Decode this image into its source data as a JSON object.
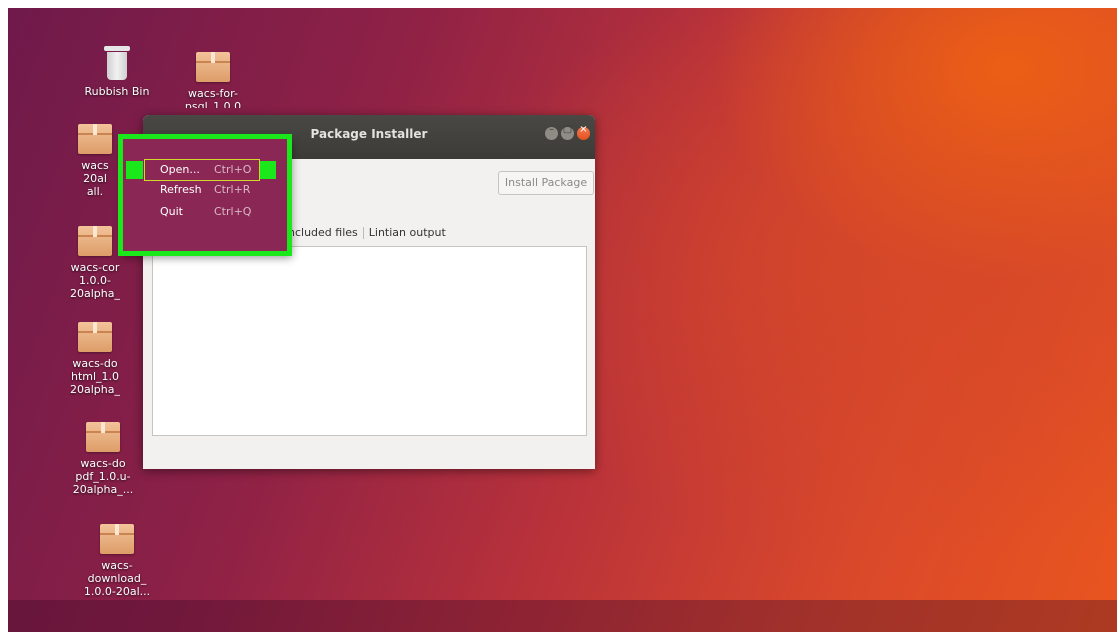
{
  "desktop": {
    "icons": [
      {
        "label": "Rubbish Bin"
      },
      {
        "label": "wacs-for-\npsql_1.0.0"
      },
      {
        "label": "wacs\n20al\nall."
      },
      {
        "label": "wacs-cor\n1.0.0-\n20alpha_"
      },
      {
        "label": "wacs-do\nhtml_1.0\n20alpha_"
      },
      {
        "label": "wacs-do\npdf_1.0.u-\n20alpha_..."
      },
      {
        "label": "wacs-\ndownload_\n1.0.0-20al..."
      }
    ]
  },
  "window": {
    "title": "Package Installer",
    "controls": {
      "minimize": "–",
      "maximize": "▢",
      "close": "×"
    },
    "install_button": "Install Package",
    "tabs": [
      "ncluded files",
      "Lintian output"
    ]
  },
  "menu": {
    "items": [
      {
        "label": "Open...",
        "shortcut": "Ctrl+O"
      },
      {
        "label": "Refresh",
        "shortcut": "Ctrl+R"
      },
      {
        "label": "Quit",
        "shortcut": "Ctrl+Q"
      }
    ]
  },
  "colors": {
    "highlight": "#1be81b",
    "menu_bg": "#8b2754",
    "close_button": "#e5501d"
  }
}
